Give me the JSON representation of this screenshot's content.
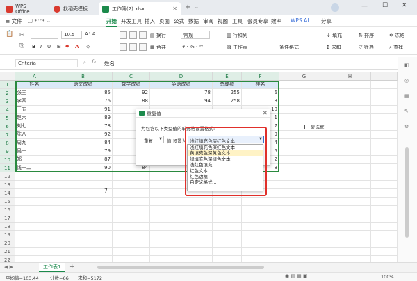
{
  "tabs": [
    {
      "label": "WPS Office",
      "color": "#d93a2f"
    },
    {
      "label": "找稻壳模板",
      "color": "#d93a2f"
    },
    {
      "label": "工作簿(2).xlsx",
      "color": "#1c8a4c"
    }
  ],
  "title_right": {
    "ai": "AI",
    "user": "用户"
  },
  "menu": {
    "file": "≡ 文件",
    "items": [
      "开始",
      "开发工具",
      "插入",
      "页面",
      "公式",
      "数据",
      "审阅",
      "视图",
      "工具",
      "会员专享",
      "效率"
    ],
    "active": "开始",
    "wps_ai": "WPS AI",
    "share": "分享"
  },
  "ribbon": {
    "font_size": "10.5",
    "wrap": "换行",
    "merge": "合并",
    "format_normal": "常规",
    "row_col": "行和列",
    "worksheet": "工作表",
    "cond_format": "条件格式",
    "fill": "填充",
    "sort": "排序",
    "freeze": "冻结",
    "sum": "求和",
    "filter": "筛选",
    "find": "查找"
  },
  "formula": {
    "name_box": "Criteria",
    "fx": "fx",
    "content": "姓名"
  },
  "columns": [
    "A",
    "B",
    "C",
    "D",
    "E",
    "F",
    "G",
    "H"
  ],
  "rows": [
    "1",
    "2",
    "3",
    "4",
    "5",
    "6",
    "7",
    "8",
    "9",
    "10",
    "11",
    "12",
    "13",
    "14",
    "15",
    "16",
    "17",
    "18",
    "19",
    "20",
    "21",
    "22"
  ],
  "table": {
    "headers": [
      "姓名",
      "语文成绩",
      "数学成绩",
      "英语成绩",
      "总成绩",
      "排名"
    ],
    "rows": [
      [
        "张三",
        "85",
        "92",
        "78",
        "255",
        "6"
      ],
      [
        "李四",
        "76",
        "88",
        "94",
        "258",
        "3"
      ],
      [
        "王五",
        "91",
        "",
        "",
        "",
        "10"
      ],
      [
        "赵六",
        "89",
        "",
        "",
        "",
        "1"
      ],
      [
        "刘七",
        "78",
        "",
        "",
        "",
        "7"
      ],
      [
        "陈八",
        "92",
        "",
        "",
        "",
        "9"
      ],
      [
        "周九",
        "84",
        "",
        "",
        "",
        "4"
      ],
      [
        "吴十",
        "79",
        "",
        "",
        "",
        "5"
      ],
      [
        "郑十一",
        "87",
        "",
        "",
        "",
        "2"
      ],
      [
        "钱十二",
        "90",
        "84",
        "",
        "",
        "8"
      ]
    ],
    "extra_value": "7",
    "checkbox_label": "复选框"
  },
  "dialog": {
    "title": "重复值",
    "prompt": "为包含以下类型值的单元格设置格式:",
    "type_select": "重复",
    "set_as": "值,设置为",
    "format_select": "浅红填充色深红色文本",
    "options": [
      "浅红填充色深红色文本",
      "黄填充色深黄色文本",
      "绿填充色深绿色文本",
      "浅红色填充",
      "红色文本",
      "红色边框",
      "自定义格式..."
    ],
    "highlighted": "黄填充色深黄色文本"
  },
  "sheet": {
    "name": "工作表1",
    "add": "+"
  },
  "status": {
    "avg": "平均值=103.44",
    "count": "计数=66",
    "sum": "求和=5172",
    "zoom": "100%"
  }
}
